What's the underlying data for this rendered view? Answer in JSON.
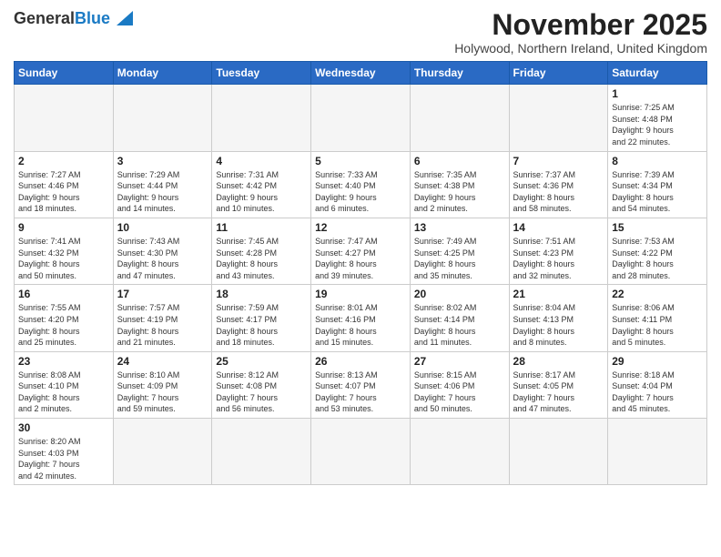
{
  "header": {
    "logo_general": "General",
    "logo_blue": "Blue",
    "month_title": "November 2025",
    "location": "Holywood, Northern Ireland, United Kingdom"
  },
  "days_of_week": [
    "Sunday",
    "Monday",
    "Tuesday",
    "Wednesday",
    "Thursday",
    "Friday",
    "Saturday"
  ],
  "weeks": [
    [
      {
        "day": "",
        "info": ""
      },
      {
        "day": "",
        "info": ""
      },
      {
        "day": "",
        "info": ""
      },
      {
        "day": "",
        "info": ""
      },
      {
        "day": "",
        "info": ""
      },
      {
        "day": "",
        "info": ""
      },
      {
        "day": "1",
        "info": "Sunrise: 7:25 AM\nSunset: 4:48 PM\nDaylight: 9 hours\nand 22 minutes."
      }
    ],
    [
      {
        "day": "2",
        "info": "Sunrise: 7:27 AM\nSunset: 4:46 PM\nDaylight: 9 hours\nand 18 minutes."
      },
      {
        "day": "3",
        "info": "Sunrise: 7:29 AM\nSunset: 4:44 PM\nDaylight: 9 hours\nand 14 minutes."
      },
      {
        "day": "4",
        "info": "Sunrise: 7:31 AM\nSunset: 4:42 PM\nDaylight: 9 hours\nand 10 minutes."
      },
      {
        "day": "5",
        "info": "Sunrise: 7:33 AM\nSunset: 4:40 PM\nDaylight: 9 hours\nand 6 minutes."
      },
      {
        "day": "6",
        "info": "Sunrise: 7:35 AM\nSunset: 4:38 PM\nDaylight: 9 hours\nand 2 minutes."
      },
      {
        "day": "7",
        "info": "Sunrise: 7:37 AM\nSunset: 4:36 PM\nDaylight: 8 hours\nand 58 minutes."
      },
      {
        "day": "8",
        "info": "Sunrise: 7:39 AM\nSunset: 4:34 PM\nDaylight: 8 hours\nand 54 minutes."
      }
    ],
    [
      {
        "day": "9",
        "info": "Sunrise: 7:41 AM\nSunset: 4:32 PM\nDaylight: 8 hours\nand 50 minutes."
      },
      {
        "day": "10",
        "info": "Sunrise: 7:43 AM\nSunset: 4:30 PM\nDaylight: 8 hours\nand 47 minutes."
      },
      {
        "day": "11",
        "info": "Sunrise: 7:45 AM\nSunset: 4:28 PM\nDaylight: 8 hours\nand 43 minutes."
      },
      {
        "day": "12",
        "info": "Sunrise: 7:47 AM\nSunset: 4:27 PM\nDaylight: 8 hours\nand 39 minutes."
      },
      {
        "day": "13",
        "info": "Sunrise: 7:49 AM\nSunset: 4:25 PM\nDaylight: 8 hours\nand 35 minutes."
      },
      {
        "day": "14",
        "info": "Sunrise: 7:51 AM\nSunset: 4:23 PM\nDaylight: 8 hours\nand 32 minutes."
      },
      {
        "day": "15",
        "info": "Sunrise: 7:53 AM\nSunset: 4:22 PM\nDaylight: 8 hours\nand 28 minutes."
      }
    ],
    [
      {
        "day": "16",
        "info": "Sunrise: 7:55 AM\nSunset: 4:20 PM\nDaylight: 8 hours\nand 25 minutes."
      },
      {
        "day": "17",
        "info": "Sunrise: 7:57 AM\nSunset: 4:19 PM\nDaylight: 8 hours\nand 21 minutes."
      },
      {
        "day": "18",
        "info": "Sunrise: 7:59 AM\nSunset: 4:17 PM\nDaylight: 8 hours\nand 18 minutes."
      },
      {
        "day": "19",
        "info": "Sunrise: 8:01 AM\nSunset: 4:16 PM\nDaylight: 8 hours\nand 15 minutes."
      },
      {
        "day": "20",
        "info": "Sunrise: 8:02 AM\nSunset: 4:14 PM\nDaylight: 8 hours\nand 11 minutes."
      },
      {
        "day": "21",
        "info": "Sunrise: 8:04 AM\nSunset: 4:13 PM\nDaylight: 8 hours\nand 8 minutes."
      },
      {
        "day": "22",
        "info": "Sunrise: 8:06 AM\nSunset: 4:11 PM\nDaylight: 8 hours\nand 5 minutes."
      }
    ],
    [
      {
        "day": "23",
        "info": "Sunrise: 8:08 AM\nSunset: 4:10 PM\nDaylight: 8 hours\nand 2 minutes."
      },
      {
        "day": "24",
        "info": "Sunrise: 8:10 AM\nSunset: 4:09 PM\nDaylight: 7 hours\nand 59 minutes."
      },
      {
        "day": "25",
        "info": "Sunrise: 8:12 AM\nSunset: 4:08 PM\nDaylight: 7 hours\nand 56 minutes."
      },
      {
        "day": "26",
        "info": "Sunrise: 8:13 AM\nSunset: 4:07 PM\nDaylight: 7 hours\nand 53 minutes."
      },
      {
        "day": "27",
        "info": "Sunrise: 8:15 AM\nSunset: 4:06 PM\nDaylight: 7 hours\nand 50 minutes."
      },
      {
        "day": "28",
        "info": "Sunrise: 8:17 AM\nSunset: 4:05 PM\nDaylight: 7 hours\nand 47 minutes."
      },
      {
        "day": "29",
        "info": "Sunrise: 8:18 AM\nSunset: 4:04 PM\nDaylight: 7 hours\nand 45 minutes."
      }
    ],
    [
      {
        "day": "30",
        "info": "Sunrise: 8:20 AM\nSunset: 4:03 PM\nDaylight: 7 hours\nand 42 minutes."
      },
      {
        "day": "",
        "info": ""
      },
      {
        "day": "",
        "info": ""
      },
      {
        "day": "",
        "info": ""
      },
      {
        "day": "",
        "info": ""
      },
      {
        "day": "",
        "info": ""
      },
      {
        "day": "",
        "info": ""
      }
    ]
  ]
}
